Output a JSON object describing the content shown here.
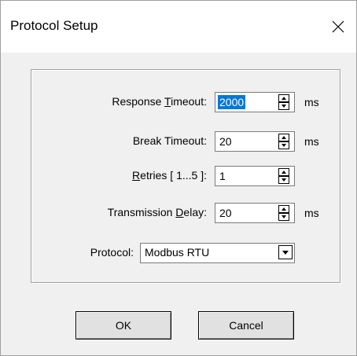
{
  "window": {
    "title": "Protocol Setup",
    "close_icon": "close-icon"
  },
  "fields": {
    "response_timeout": {
      "label_pre": "Response ",
      "label_mnemonic": "T",
      "label_post": "imeout:",
      "value": "2000",
      "unit": "ms"
    },
    "break_timeout": {
      "label": "Break Timeout:",
      "value": "20",
      "unit": "ms"
    },
    "retries": {
      "label_mnemonic": "R",
      "label_post": "etries [ 1...5 ]:",
      "value": "1"
    },
    "transmission_delay": {
      "label_pre": "Transmission ",
      "label_mnemonic": "D",
      "label_post": "elay:",
      "value": "20",
      "unit": "ms"
    },
    "protocol": {
      "label": "Protocol:",
      "value": "Modbus RTU"
    }
  },
  "buttons": {
    "ok": "OK",
    "cancel": "Cancel"
  }
}
